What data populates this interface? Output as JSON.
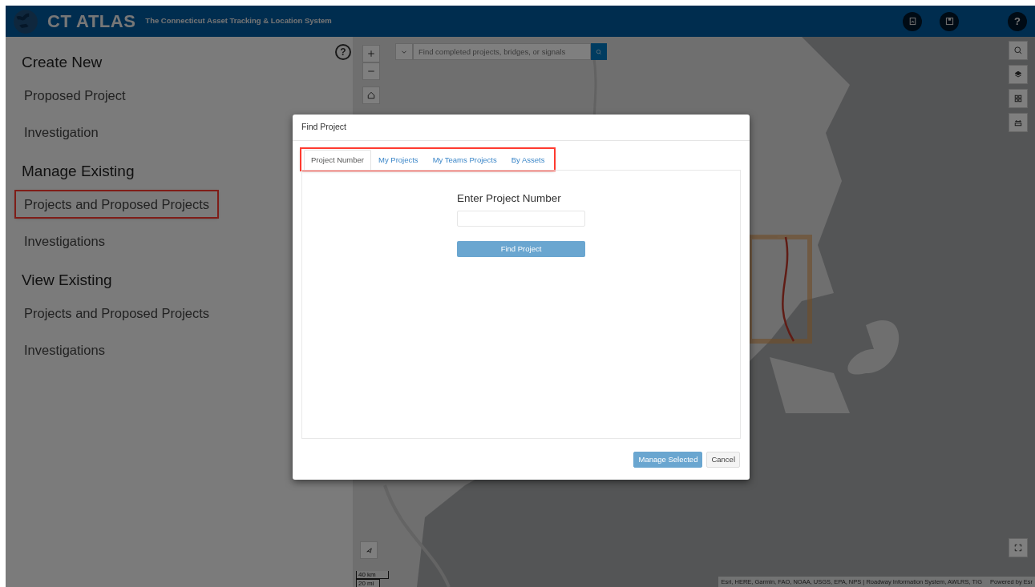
{
  "header": {
    "title": "CT ATLAS",
    "subtitle": "The Connecticut Asset Tracking & Location System",
    "help_label": "?"
  },
  "sidebar": {
    "help_label": "?",
    "sections": [
      {
        "heading": "Create New",
        "items": [
          {
            "label": "Proposed Project",
            "highlighted": false
          },
          {
            "label": "Investigation",
            "highlighted": false
          }
        ]
      },
      {
        "heading": "Manage Existing",
        "items": [
          {
            "label": "Projects and Proposed Projects",
            "highlighted": true
          },
          {
            "label": "Investigations",
            "highlighted": false
          }
        ]
      },
      {
        "heading": "View Existing",
        "items": [
          {
            "label": "Projects and Proposed Projects",
            "highlighted": false
          },
          {
            "label": "Investigations",
            "highlighted": false
          }
        ]
      }
    ]
  },
  "map": {
    "search": {
      "placeholder": "Find completed projects, bridges, or signals"
    },
    "scale": [
      "40 km",
      "20 mi"
    ],
    "attribution": "Esri, HERE, Garmin, FAO, NOAA, USGS, EPA, NPS | Roadway Information System, AWLRS, TIG",
    "powered_by": "Powered by Esr"
  },
  "dialog": {
    "title": "Find Project",
    "tabs_highlighted": true,
    "tabs": [
      {
        "label": "Project Number",
        "selected": true
      },
      {
        "label": "My Projects",
        "selected": false
      },
      {
        "label": "My Teams Projects",
        "selected": false
      },
      {
        "label": "By Assets",
        "selected": false
      }
    ],
    "field_label": "Enter Project Number",
    "find_button": "Find Project",
    "buttons": [
      {
        "label": "Manage Selected",
        "kind": "primary"
      },
      {
        "label": "Cancel",
        "kind": "secondary"
      }
    ]
  }
}
